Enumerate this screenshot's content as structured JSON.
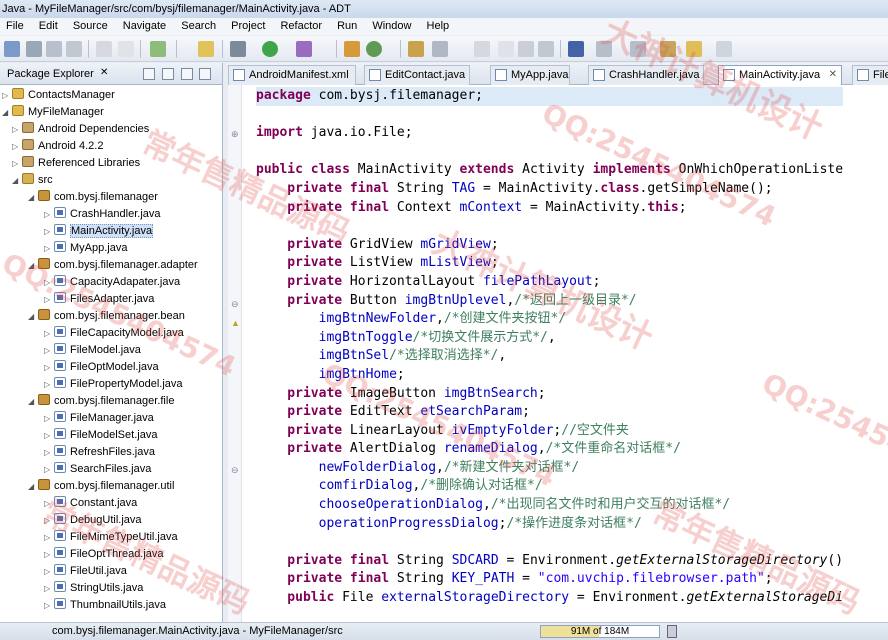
{
  "window": {
    "title": "Java - MyFileManager/src/com/bysj/filemanager/MainActivity.java - ADT"
  },
  "menu": [
    "File",
    "Edit",
    "Source",
    "Navigate",
    "Search",
    "Project",
    "Refactor",
    "Run",
    "Window",
    "Help"
  ],
  "explorer": {
    "title": "Package Explorer",
    "close": "✕",
    "items": [
      {
        "label": "ContactsManager"
      },
      {
        "label": "MyFileManager"
      },
      {
        "label": "Android Dependencies"
      },
      {
        "label": "Android 4.2.2"
      },
      {
        "label": "Referenced Libraries"
      },
      {
        "label": "src"
      },
      {
        "label": "com.bysj.filemanager"
      },
      {
        "label": "CrashHandler.java"
      },
      {
        "label": "MainActivity.java"
      },
      {
        "label": "MyApp.java"
      },
      {
        "label": "com.bysj.filemanager.adapter"
      },
      {
        "label": "CapacityAdapater.java"
      },
      {
        "label": "FilesAdapter.java"
      },
      {
        "label": "com.bysj.filemanager.bean"
      },
      {
        "label": "FileCapacityModel.java"
      },
      {
        "label": "FileModel.java"
      },
      {
        "label": "FileOptModel.java"
      },
      {
        "label": "FilePropertyModel.java"
      },
      {
        "label": "com.bysj.filemanager.file"
      },
      {
        "label": "FileManager.java"
      },
      {
        "label": "FileModelSet.java"
      },
      {
        "label": "RefreshFiles.java"
      },
      {
        "label": "SearchFiles.java"
      },
      {
        "label": "com.bysj.filemanager.util"
      },
      {
        "label": "Constant.java"
      },
      {
        "label": "DebugUtil.java"
      },
      {
        "label": "FileMimeTypeUtil.java"
      },
      {
        "label": "FileOptThread.java"
      },
      {
        "label": "FileUtil.java"
      },
      {
        "label": "StringUtils.java"
      },
      {
        "label": "ThumbnailUtils.java"
      }
    ]
  },
  "editor": {
    "tabs": [
      "AndroidManifest.xml",
      "EditContact.java",
      "MyApp.java",
      "CrashHandler.java",
      "MainActivity.java",
      "File"
    ],
    "active_tab": "MainActivity.java",
    "tab_close": "✕",
    "code": [
      {
        "k": "package",
        "rest": " com.bysj.filemanager;"
      },
      {
        "k": "",
        "rest": ""
      },
      {
        "k": "import",
        "rest": " java.io.File;"
      },
      {
        "k": "",
        "rest": ""
      },
      {
        "k": "public class",
        "rest": " MainActivity ",
        "k2": "extends",
        "rest2": " Activity ",
        "k3": "implements",
        "rest3": " OnWhichOperationListe"
      },
      {
        "k": "    private final",
        "rest": " String ",
        "f": "TAG",
        "rest2": " = MainActivity.",
        "k2": "class",
        "rest3": ".getSimpleName();"
      },
      {
        "k": "    private final",
        "rest": " Context ",
        "f": "mContext",
        "rest2": " = MainActivity.",
        "k2": "this",
        "rest3": ";"
      },
      {
        "k": "",
        "rest": ""
      },
      {
        "k": "    private",
        "rest": " GridView ",
        "f": "mGridView",
        "rest2": ";"
      },
      {
        "k": "    private",
        "rest": " ListView ",
        "f": "mListView",
        "rest2": ";"
      },
      {
        "k": "    private",
        "rest": " HorizontalLayout ",
        "f": "filePathLayout",
        "rest2": ";"
      },
      {
        "k": "    private",
        "rest": " Button ",
        "f": "imgBtnUplevel",
        "rest2": ",",
        "c": "/*返回上一级目录*/"
      },
      {
        "k": "",
        "rest": "        ",
        "f": "imgBtnNewFolder",
        "rest2": ",",
        "c": "/*创建文件夹按钮*/"
      },
      {
        "k": "",
        "rest": "        ",
        "f": "imgBtnToggle",
        "rest2": "",
        "c": "/*切换文件展示方式*/",
        "tail": ","
      },
      {
        "k": "",
        "rest": "        ",
        "f": "imgBtnSel",
        "rest2": "",
        "c": "/*选择取消选择*/",
        "tail": ","
      },
      {
        "k": "",
        "rest": "        ",
        "f": "imgBtnHome",
        "rest2": ";"
      },
      {
        "k": "    private",
        "rest": " ImageButton ",
        "f": "imgBtnSearch",
        "rest2": ";"
      },
      {
        "k": "    private",
        "rest": " EditText ",
        "f": "etSearchParam",
        "rest2": ";"
      },
      {
        "k": "    private",
        "rest": " LinearLayout ",
        "f": "ivEmptyFolder",
        "rest2": ";",
        "c": "//空文件夹"
      },
      {
        "k": "    private",
        "rest": " AlertDialog ",
        "f": "renameDialog",
        "rest2": ",",
        "c": "/*文件重命名对话框*/"
      },
      {
        "k": "",
        "rest": "        ",
        "f": "newFolderDialog",
        "rest2": ",",
        "c": "/*新建文件夹对话框*/"
      },
      {
        "k": "",
        "rest": "        ",
        "f": "comfirDialog",
        "rest2": ",",
        "c": "/*删除确认对话框*/"
      },
      {
        "k": "",
        "rest": "        ",
        "f": "chooseOperationDialog",
        "rest2": ",",
        "c": "/*出现同名文件时和用户交互的对话框*/"
      },
      {
        "k": "",
        "rest": "        ",
        "f": "operationProgressDialog",
        "rest2": ";",
        "c": "/*操作进度条对话框*/"
      },
      {
        "k": "",
        "rest": ""
      },
      {
        "k": "    private final",
        "rest": " String ",
        "f": "SDCARD",
        "rest2": " = Environment.",
        "i": "getExternalStorageDirectory",
        "rest3": "()"
      },
      {
        "k": "    private final",
        "rest": " String ",
        "f": "KEY_PATH",
        "rest2": " = ",
        "s": "\"com.uvchip.filebrowser.path\"",
        "rest3": ";"
      },
      {
        "k": "    public",
        "rest": " File ",
        "f": "externalStorageDirectory",
        "rest2": " = Environment.",
        "i": "getExternalStorageDi",
        "rest3": ""
      }
    ]
  },
  "status": {
    "selection": "com.bysj.filemanager.MainActivity.java - MyFileManager/src",
    "heap": "91M of 184M",
    "heap_used_mb": 91,
    "heap_total_mb": 184
  },
  "watermarks": [
    "大神计算机设计",
    "常年售精品源码",
    "QQ:2545404574"
  ]
}
